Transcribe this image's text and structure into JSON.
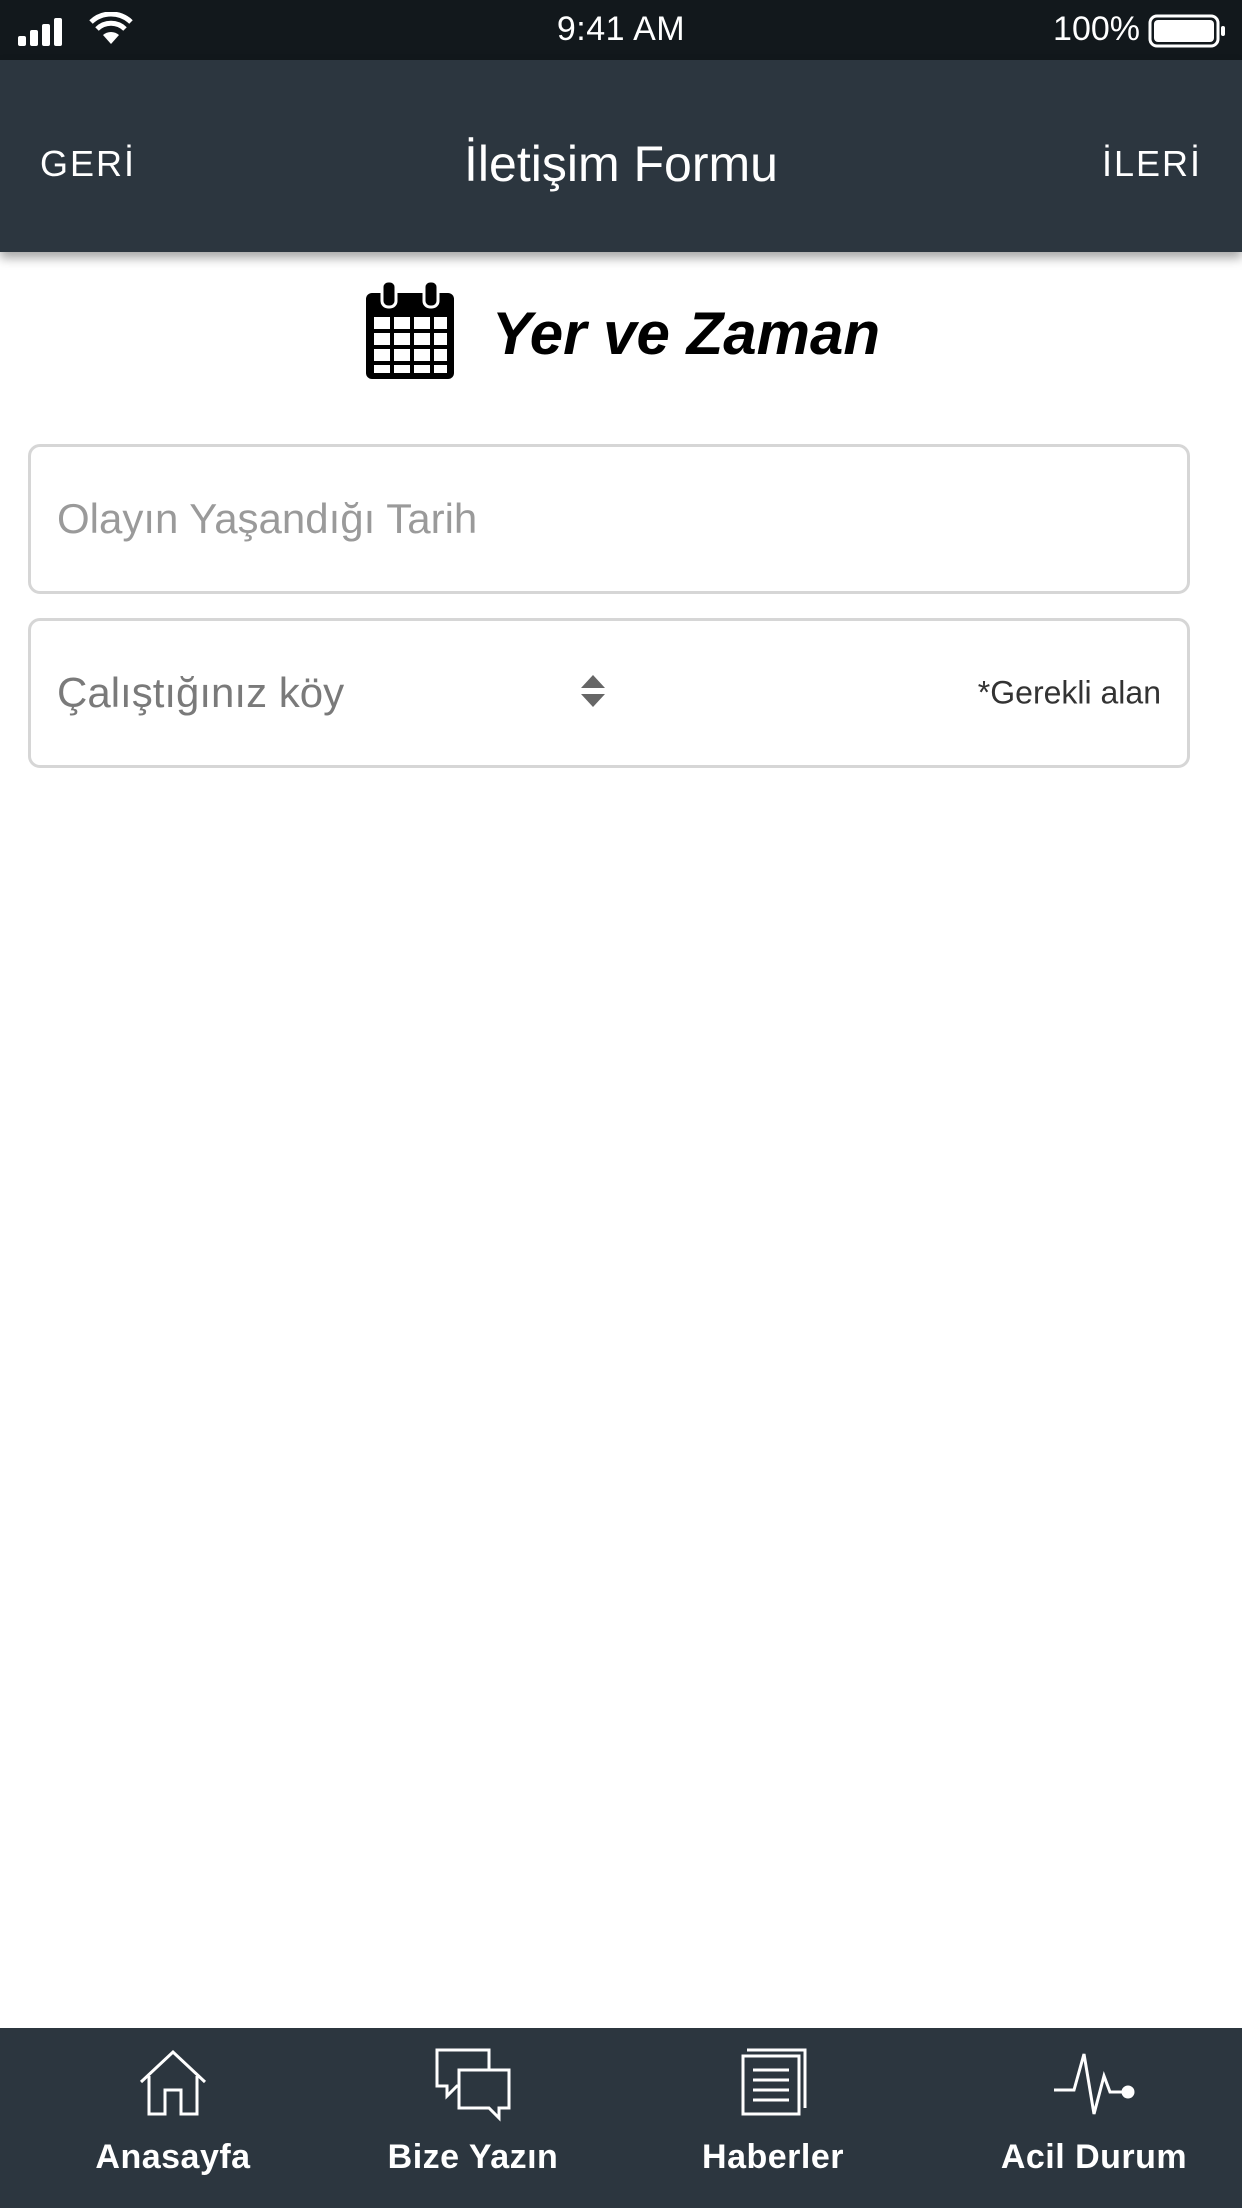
{
  "status_bar": {
    "time": "9:41 AM",
    "battery": "100%",
    "icons": [
      "signal-icon",
      "wifi-icon",
      "battery-icon"
    ]
  },
  "nav": {
    "back_label": "GERİ",
    "title": "İletişim Formu",
    "next_label": "İLERİ"
  },
  "section": {
    "icon": "calendar-icon",
    "title": "Yer ve Zaman"
  },
  "form": {
    "date_field": {
      "placeholder": "Olayın Yaşandığı Tarih",
      "value": ""
    },
    "village_field": {
      "placeholder": "Çalıştığınız köy",
      "required_label": "*Gerekli alan"
    }
  },
  "tabs": [
    {
      "label": "Anasayfa",
      "icon": "home-icon"
    },
    {
      "label": "Bize Yazın",
      "icon": "chat-icon"
    },
    {
      "label": "Haberler",
      "icon": "news-icon"
    },
    {
      "label": "Acil Durum",
      "icon": "heartbeat-icon"
    }
  ],
  "colors": {
    "bar_background": "#2c363f",
    "status_bar_background": "#12181c",
    "field_border": "#d6d6d6",
    "placeholder": "#9a9a9a"
  }
}
